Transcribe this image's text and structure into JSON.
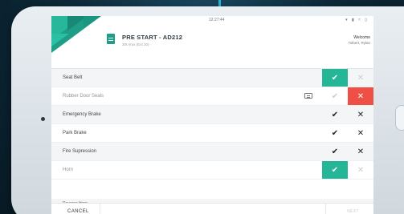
{
  "status_bar": {
    "time": "12:27:44",
    "icons": "▾ ▮ ≈ ▯"
  },
  "header": {
    "title": "PRE START - AD212",
    "subtitle": "30t Aros (Ext 30)",
    "welcome": "Welcome",
    "user": "Tolbert, Rylan"
  },
  "checklist": [
    {
      "label": "Seat Belt",
      "yes": "✔",
      "no": "✕",
      "state": "pass"
    },
    {
      "label": "Rubber Door Seals",
      "yes": "✔",
      "no": "✕",
      "state": "fail",
      "has_comment": true
    },
    {
      "label": "Emergency Brake",
      "yes": "✔",
      "no": "✕",
      "state": "none"
    },
    {
      "label": "Park Brake",
      "yes": "✔",
      "no": "✕",
      "state": "none"
    },
    {
      "label": "Fire Supression",
      "yes": "✔",
      "no": "✕",
      "state": "none"
    },
    {
      "label": "Horn",
      "yes": "✔",
      "no": "✕",
      "state": "pass"
    }
  ],
  "partial_item": "Reverse Horn",
  "footer": {
    "cancel": "CANCEL",
    "next": "NEXT"
  },
  "colors": {
    "accent": "#25b597",
    "danger": "#ee5046",
    "brand_dark": "#1e9e86"
  },
  "icons": {
    "doc": "document-icon",
    "comment": "comment-icon",
    "check": "check-icon",
    "cross": "cross-icon"
  }
}
